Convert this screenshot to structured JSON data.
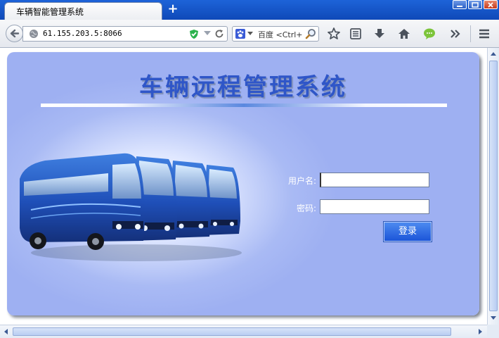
{
  "browser": {
    "tab_title": "车辆智能管理系统",
    "new_tab_symbol": "+",
    "address": "61.155.203.5:8066",
    "search_engine": "baidu-icon",
    "search_placeholder": "百度 <Ctrl+K>"
  },
  "page": {
    "title": "车辆远程管理系统",
    "login": {
      "username_label": "用户名:",
      "password_label": "密码:",
      "username_value": "",
      "password_value": "",
      "submit_label": "登录"
    }
  },
  "colors": {
    "panel_bg": "#9eb0f2",
    "title_text": "#2f56c8",
    "button_bg": "#2f6be0",
    "titlebar": "#1d63d8"
  },
  "icons": [
    "back-icon",
    "globe-icon",
    "shield-check-icon",
    "reload-icon",
    "search-icon",
    "star-icon",
    "reading-list-icon",
    "download-icon",
    "home-icon",
    "chat-icon",
    "overflow-icon",
    "menu-icon"
  ]
}
